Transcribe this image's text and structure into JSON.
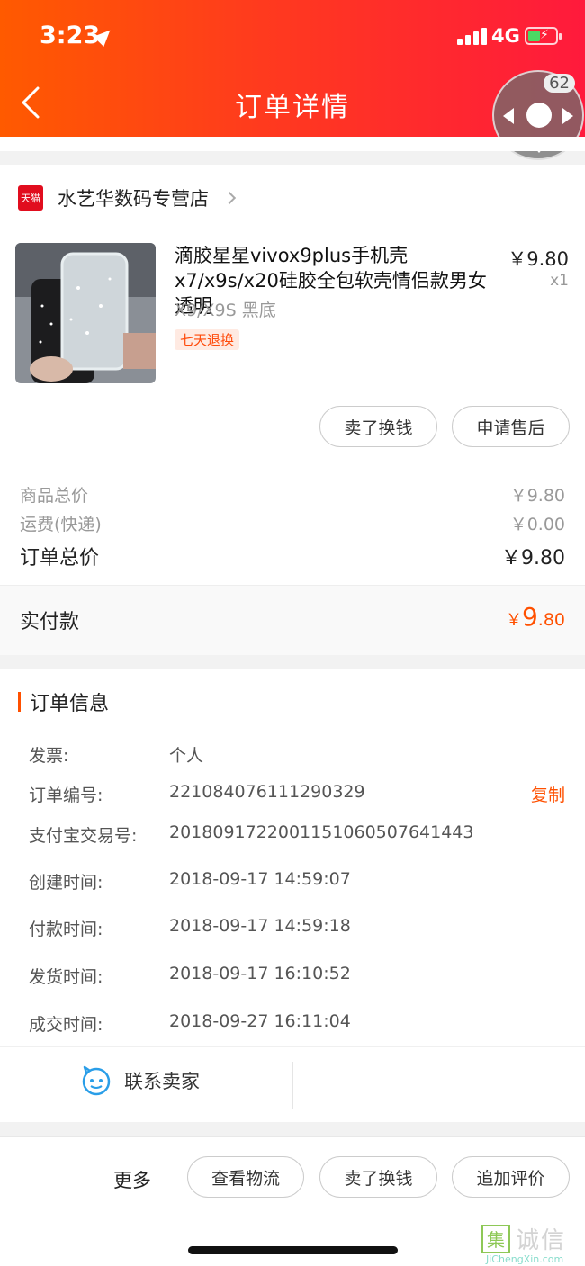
{
  "status_bar": {
    "time": "3:23",
    "network": "4G"
  },
  "header": {
    "title": "订单详情"
  },
  "float_ball": {
    "badge": "62"
  },
  "shop": {
    "badge": "天猫",
    "name": "水艺华数码专营店"
  },
  "product": {
    "title": "滴胶星星vivox9plus手机壳x7/x9s/x20硅胶全包软壳情侣款男女透明",
    "sku": "X9/X9S 黑底",
    "tag": "七天退换",
    "price": "￥9.80",
    "qty": "x1"
  },
  "item_actions": {
    "sell": "卖了换钱",
    "after_sale": "申请售后"
  },
  "summary": {
    "goods_label": "商品总价",
    "goods_value": "￥9.80",
    "shipping_label": "运费(快递)",
    "shipping_value": "￥0.00",
    "total_label": "订单总价",
    "total_value": "￥9.80"
  },
  "paid": {
    "label": "实付款",
    "currency": "￥",
    "int": "9",
    "dec": ".80"
  },
  "order_info": {
    "title": "订单信息",
    "invoice_label": "发票:",
    "invoice_value": "个人",
    "order_no_label": "订单编号:",
    "order_no_value": "221084076111290329",
    "copy_label": "复制",
    "alipay_label": "支付宝交易号:",
    "alipay_value": "2018091722001151060507641443",
    "created_label": "创建时间:",
    "created_value": "2018-09-17 14:59:07",
    "paid_label": "付款时间:",
    "paid_value": "2018-09-17 14:59:18",
    "shipped_label": "发货时间:",
    "shipped_value": "2018-09-17 16:10:52",
    "closed_label": "成交时间:",
    "closed_value": "2018-09-27 16:11:04"
  },
  "contact": {
    "label": "联系卖家"
  },
  "bottom": {
    "more": "更多",
    "logistics": "查看物流",
    "sell": "卖了换钱",
    "review": "追加评价"
  },
  "watermark": {
    "box": "集",
    "text": "诚信",
    "domain": "JiChengXin.com"
  }
}
